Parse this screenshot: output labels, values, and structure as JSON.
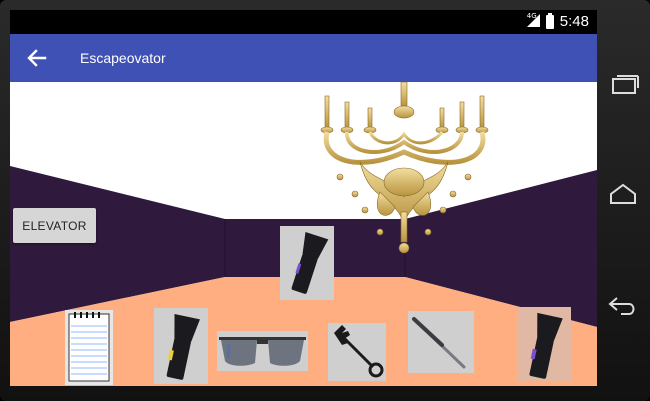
{
  "status_bar": {
    "network": "4G",
    "time": "5:48"
  },
  "app_bar": {
    "title": "Escapeovator",
    "back_icon": "arrow-left-icon"
  },
  "scene": {
    "elevator_button_label": "ELEVATOR",
    "wall_color": "#2f1a3d",
    "floor_color": "#ffae82",
    "ceiling_color": "#ffffff"
  },
  "items": [
    {
      "name": "flashlight-item",
      "icon": "flashlight-icon"
    },
    {
      "name": "notepad-item",
      "icon": "notepad-icon"
    },
    {
      "name": "flashlight-item",
      "icon": "flashlight-icon"
    },
    {
      "name": "sunglasses-item",
      "icon": "sunglasses-icon"
    },
    {
      "name": "key-item",
      "icon": "key-icon"
    },
    {
      "name": "lockpick-item",
      "icon": "lockpick-icon"
    },
    {
      "name": "flashlight-item",
      "icon": "flashlight-icon"
    }
  ],
  "nav_bar": {
    "recents_icon": "recents-icon",
    "home_icon": "home-icon",
    "back_icon": "back-icon"
  }
}
